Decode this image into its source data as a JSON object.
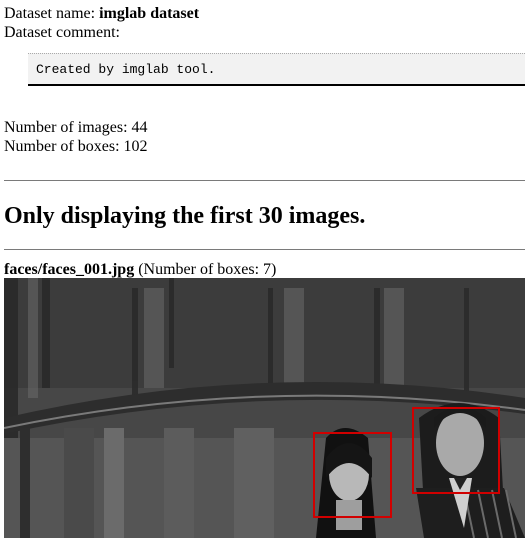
{
  "dataset": {
    "name_label": "Dataset name:",
    "name_value": "imglab dataset",
    "comment_label": "Dataset comment:",
    "comment_text": "Created by imglab tool."
  },
  "stats": {
    "images_label": "Number of images:",
    "images_value": "44",
    "boxes_label": "Number of boxes:",
    "boxes_value": "102"
  },
  "notice": "Only displaying the first 30 images.",
  "image": {
    "filename": "faces/faces_001.jpg",
    "boxes_label": "(Number of boxes: 7)",
    "box_color": "#d10000"
  }
}
